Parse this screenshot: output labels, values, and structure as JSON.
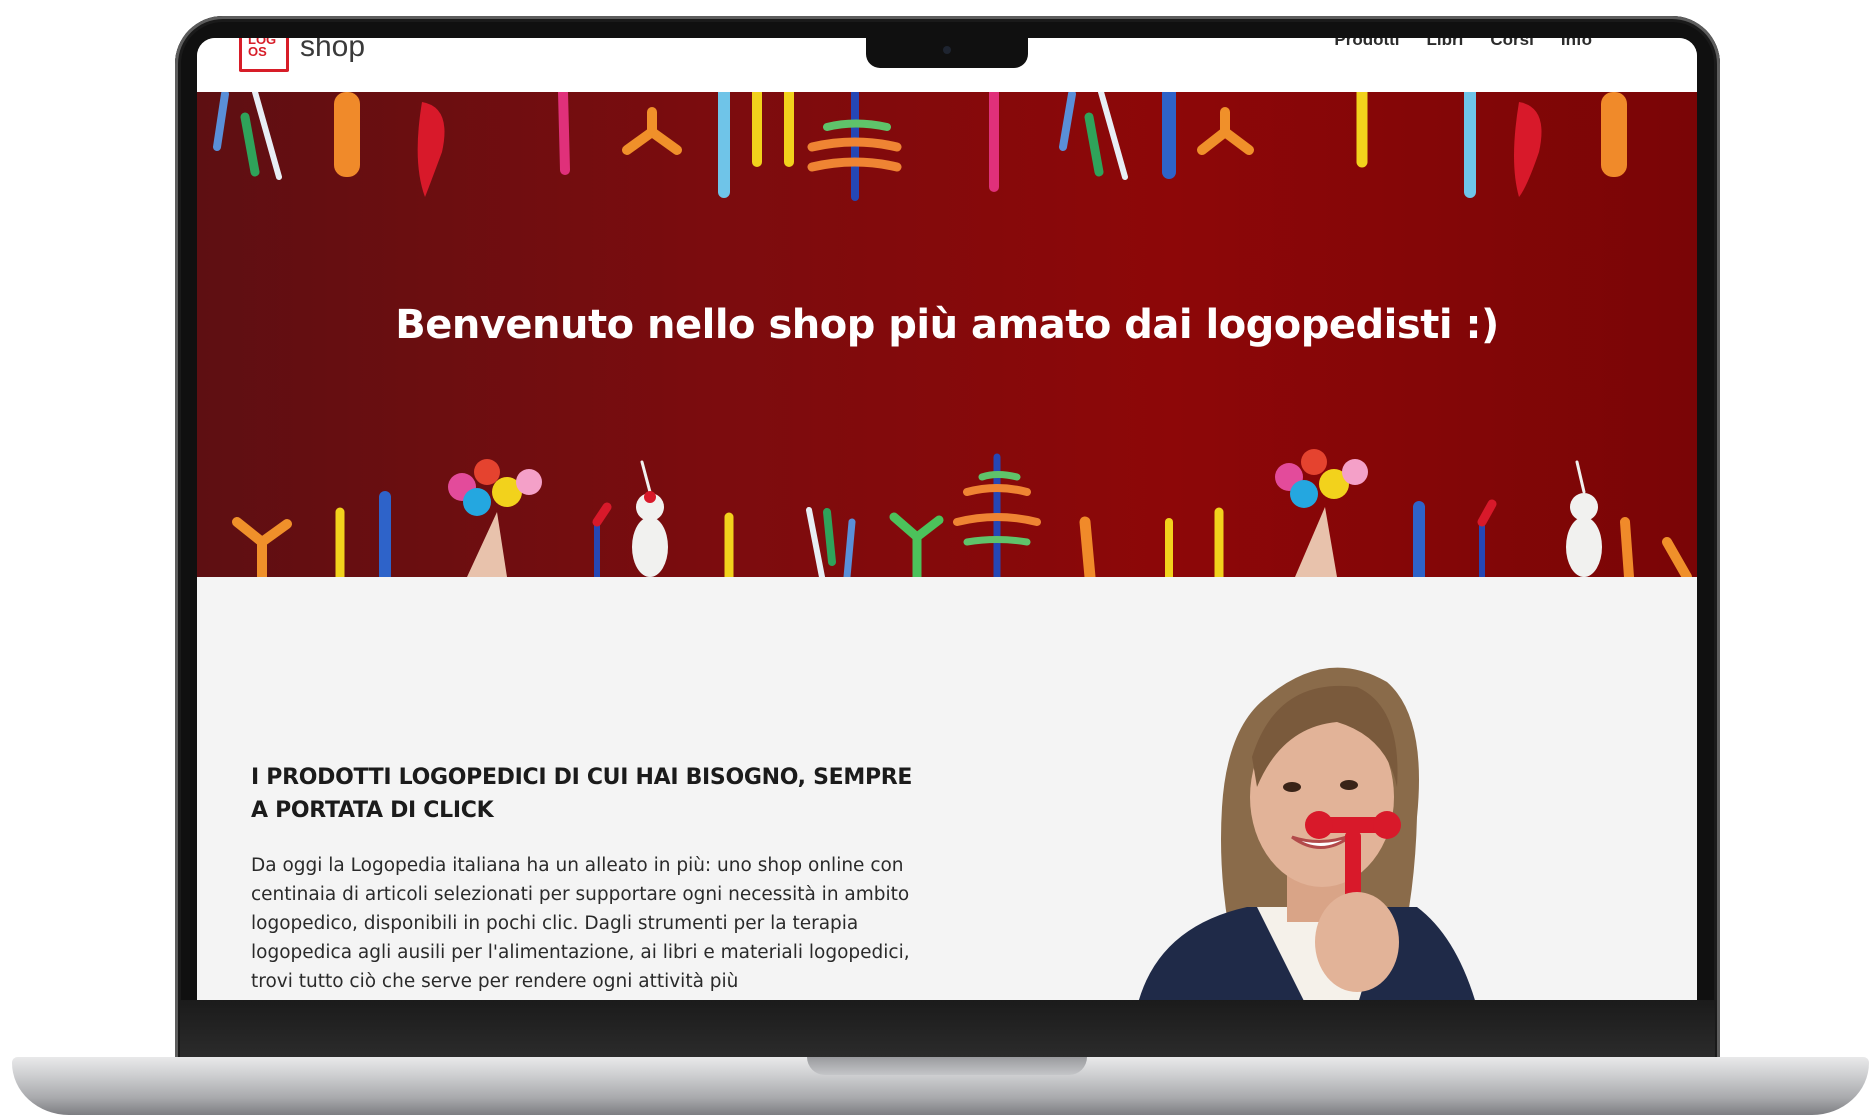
{
  "header": {
    "logo_mark": "LOG\nOS",
    "logo_word": "shop",
    "nav": [
      "Prodotti",
      "Libri",
      "Corsi",
      "Info"
    ]
  },
  "hero": {
    "title": "Benvenuto nello shop più amato dai logopedisti :)"
  },
  "section": {
    "title": "I PRODOTTI LOGOPEDICI DI CUI HAI BISOGNO, SEMPRE A PORTATA DI CLICK",
    "body": "Da oggi la Logopedia italiana ha un alleato in più: uno shop online con centinaia di articoli selezionati per supportare ogni necessità in ambito logopedico, disponibili in pochi clic. Dagli strumenti per la terapia logopedica agli ausili per l'alimentazione, ai libri e materiali logopedici, trovi tutto ciò che serve per rendere ogni attività più"
  },
  "colors": {
    "brand_red": "#d71d28",
    "hero_red": "#8d0708",
    "page_bg": "#f4f4f4"
  }
}
